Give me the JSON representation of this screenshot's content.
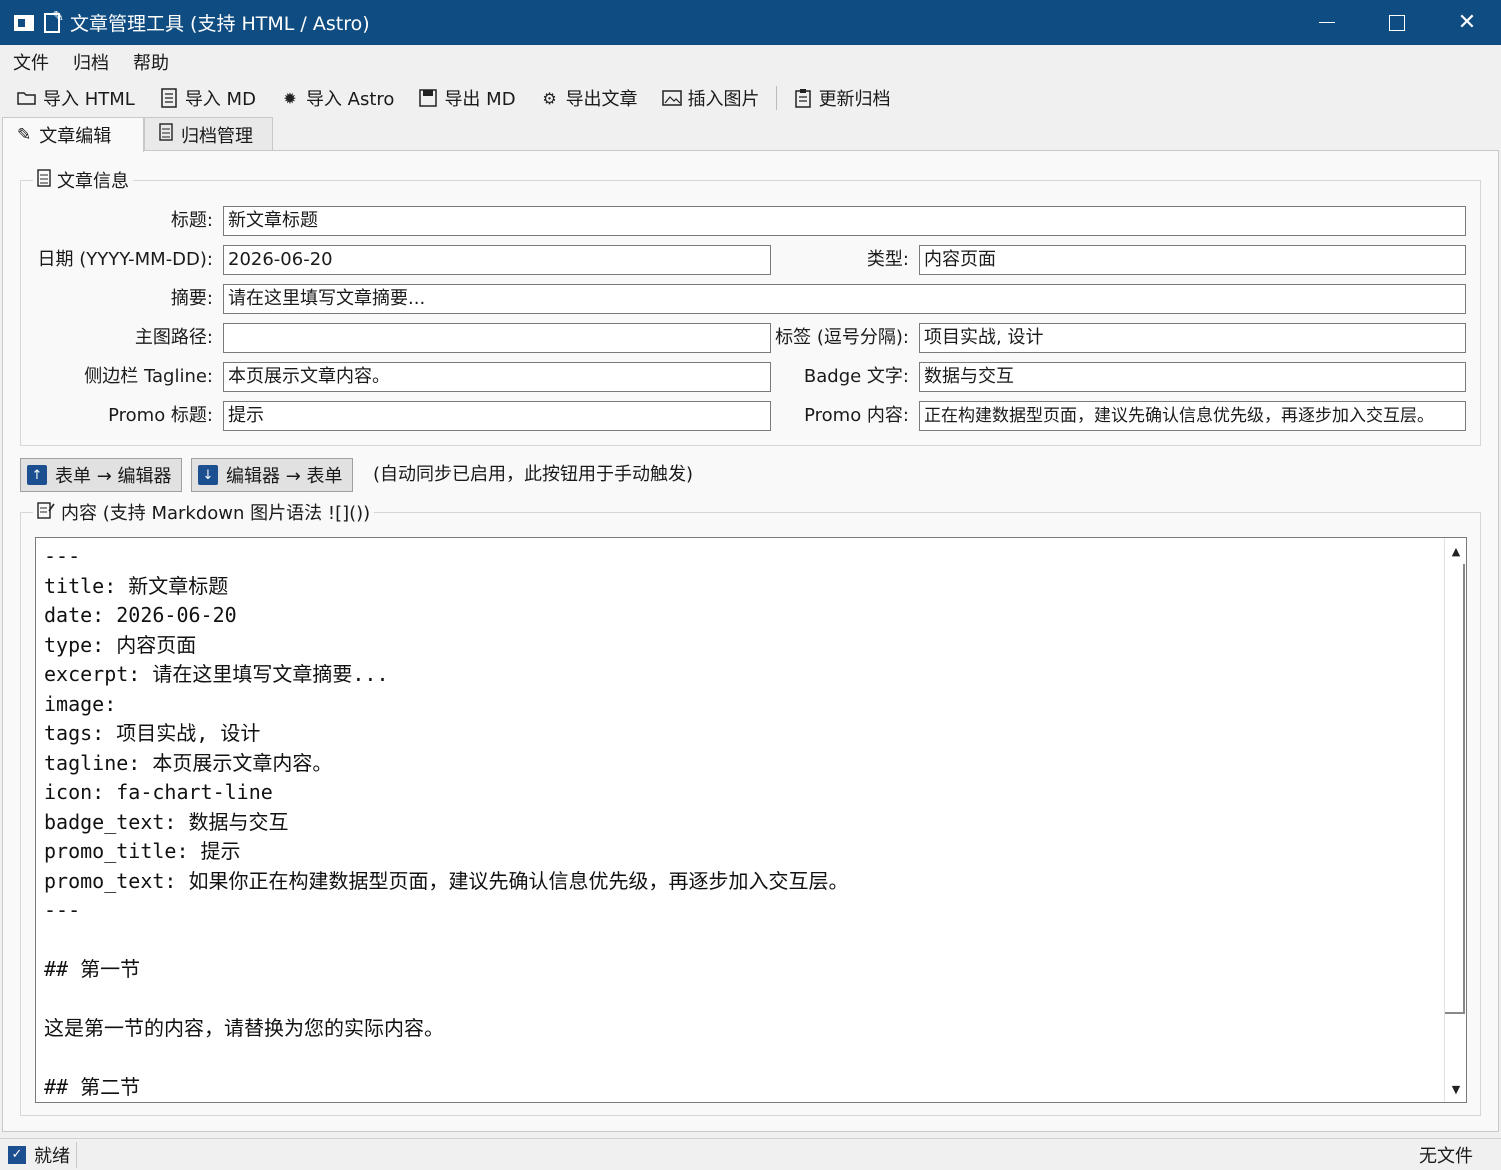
{
  "window": {
    "title": "文章管理工具 (支持 HTML / Astro)",
    "minimize": "—",
    "maximize": "☐",
    "close": "✕"
  },
  "menu": [
    "文件",
    "归档",
    "帮助"
  ],
  "toolbar": [
    {
      "label": "导入 HTML",
      "icon": "folder-open-icon"
    },
    {
      "label": "导入 MD",
      "icon": "document-icon"
    },
    {
      "label": "导入 Astro",
      "icon": "star-burst-icon"
    },
    {
      "label": "导出 MD",
      "icon": "save-icon"
    },
    {
      "label": "导出文章",
      "icon": "gear-icon"
    },
    {
      "label": "插入图片",
      "icon": "image-icon"
    },
    {
      "label": "更新归档",
      "icon": "clipboard-icon"
    }
  ],
  "tabs": [
    {
      "label": "文章编辑",
      "icon": "pencil-icon",
      "active": true
    },
    {
      "label": "归档管理",
      "icon": "archive-icon",
      "active": false
    }
  ],
  "info_group": {
    "title": "文章信息",
    "title_label": "标题:",
    "title_value": "新文章标题",
    "date_label": "日期 (YYYY-MM-DD):",
    "date_value": "2026-06-20",
    "type_label": "类型:",
    "type_value": "内容页面",
    "excerpt_label": "摘要:",
    "excerpt_value": "请在这里填写文章摘要...",
    "image_label": "主图路径:",
    "image_value": "",
    "tags_label": "标签 (逗号分隔):",
    "tags_value": "项目实战, 设计",
    "tagline_label": "侧边栏 Tagline:",
    "tagline_value": "本页展示文章内容。",
    "badge_label": "Badge 文字:",
    "badge_value": "数据与交互",
    "promo_title_label": "Promo 标题:",
    "promo_title_value": "提示",
    "promo_text_label": "Promo 内容:",
    "promo_text_value": "正在构建数据型页面，建议先确认信息优先级，再逐步加入交互层。"
  },
  "sync": {
    "to_editor": "表单 → 编辑器",
    "to_form": "编辑器 → 表单",
    "note": "(自动同步已启用，此按钮用于手动触发)"
  },
  "content_group": {
    "title": "内容 (支持 Markdown 图片语法 ![]())",
    "text": "---\ntitle: 新文章标题\ndate: 2026-06-20\ntype: 内容页面\nexcerpt: 请在这里填写文章摘要...\nimage:\ntags: 项目实战, 设计\ntagline: 本页展示文章内容。\nicon: fa-chart-line\nbadge_text: 数据与交互\npromo_title: 提示\npromo_text: 如果你正在构建数据型页面，建议先确认信息优先级，再逐步加入交互层。\n---\n\n## 第一节\n\n这是第一节的内容，请替换为您的实际内容。\n\n## 第二节"
  },
  "status": {
    "left": "就绪",
    "right": "无文件"
  }
}
